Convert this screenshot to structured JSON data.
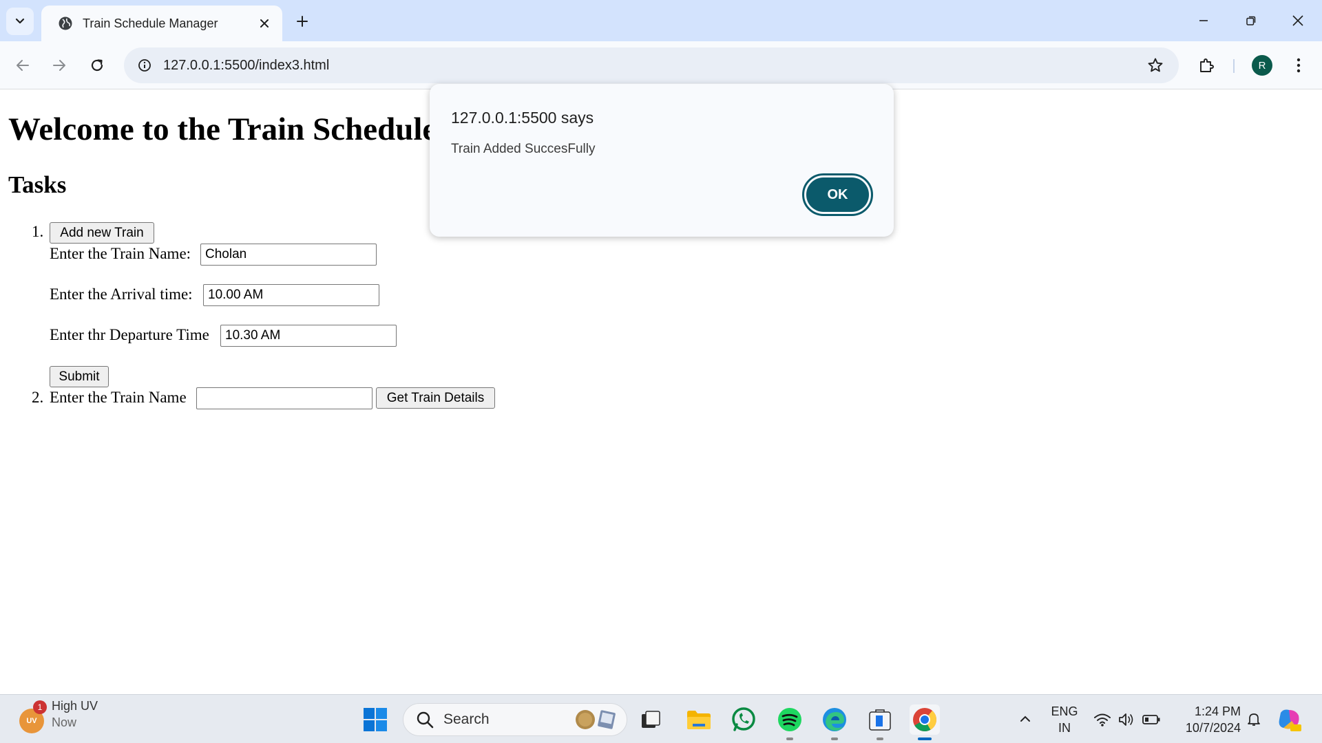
{
  "browser": {
    "tab_title": "Train Schedule Manager",
    "url": "127.0.0.1:5500/index3.html",
    "profile_initial": "R"
  },
  "page": {
    "heading": "Welcome to the Train Schedule Manager",
    "subheading": "Tasks",
    "task1": {
      "number": "1.",
      "add_button": "Add new Train",
      "name_label": "Enter the Train Name:",
      "name_value": "Cholan",
      "arrival_label": "Enter the Arrival time:",
      "arrival_value": "10.00 AM",
      "departure_label": "Enter thr Departure Time",
      "departure_value": "10.30 AM",
      "submit_button": "Submit"
    },
    "task2": {
      "number": "2.",
      "name_label": "Enter the Train Name",
      "name_value": "",
      "details_button": "Get Train Details"
    }
  },
  "dialog": {
    "title": "127.0.0.1:5500 says",
    "message": "Train Added SuccesFully",
    "ok_label": "OK"
  },
  "taskbar": {
    "weather_title": "High UV",
    "weather_sub": "Now",
    "weather_badge": "1",
    "weather_icon_text": "UV",
    "search_placeholder": "Search",
    "lang_line1": "ENG",
    "lang_line2": "IN",
    "time": "1:24 PM",
    "date": "10/7/2024",
    "apps": [
      "file-explorer-app",
      "folder-app",
      "whatsapp-app",
      "spotify-app",
      "edge-app",
      "store-app",
      "chrome-app"
    ]
  },
  "colors": {
    "tabstrip": "#d3e3fd",
    "dialog_button": "#0b5a6b",
    "profile": "#0b5a4c",
    "taskbar": "#e6eaf0"
  }
}
